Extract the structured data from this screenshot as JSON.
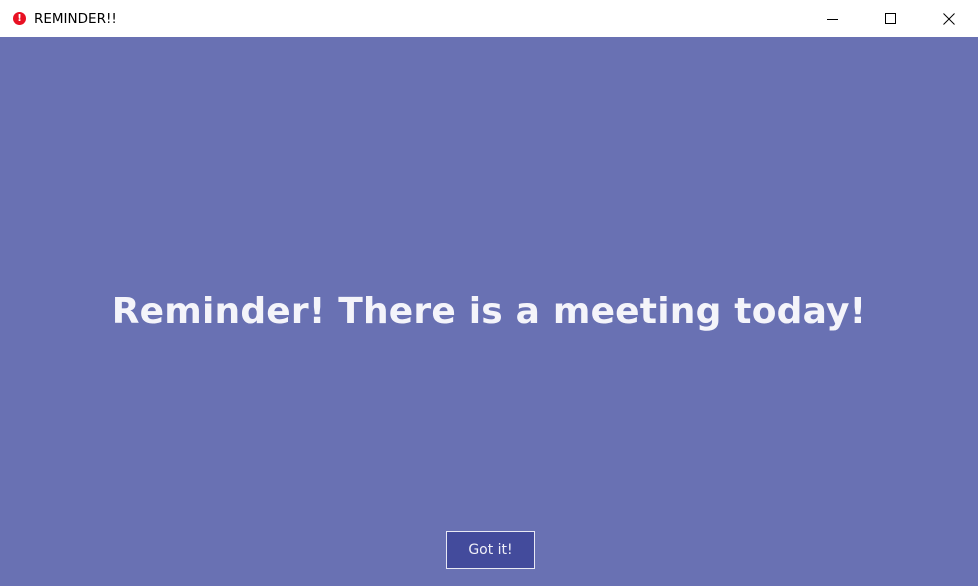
{
  "window": {
    "title": "REMINDER!!",
    "icon": "exclamation-circle-icon",
    "controls": [
      "minimize-icon",
      "maximize-icon",
      "close-icon"
    ]
  },
  "main": {
    "message": "Reminder! There is a meeting today!",
    "button_label": "Got it!"
  },
  "colors": {
    "background": "#6971b3",
    "button": "#434b9c",
    "alert_icon": "#e81123"
  }
}
